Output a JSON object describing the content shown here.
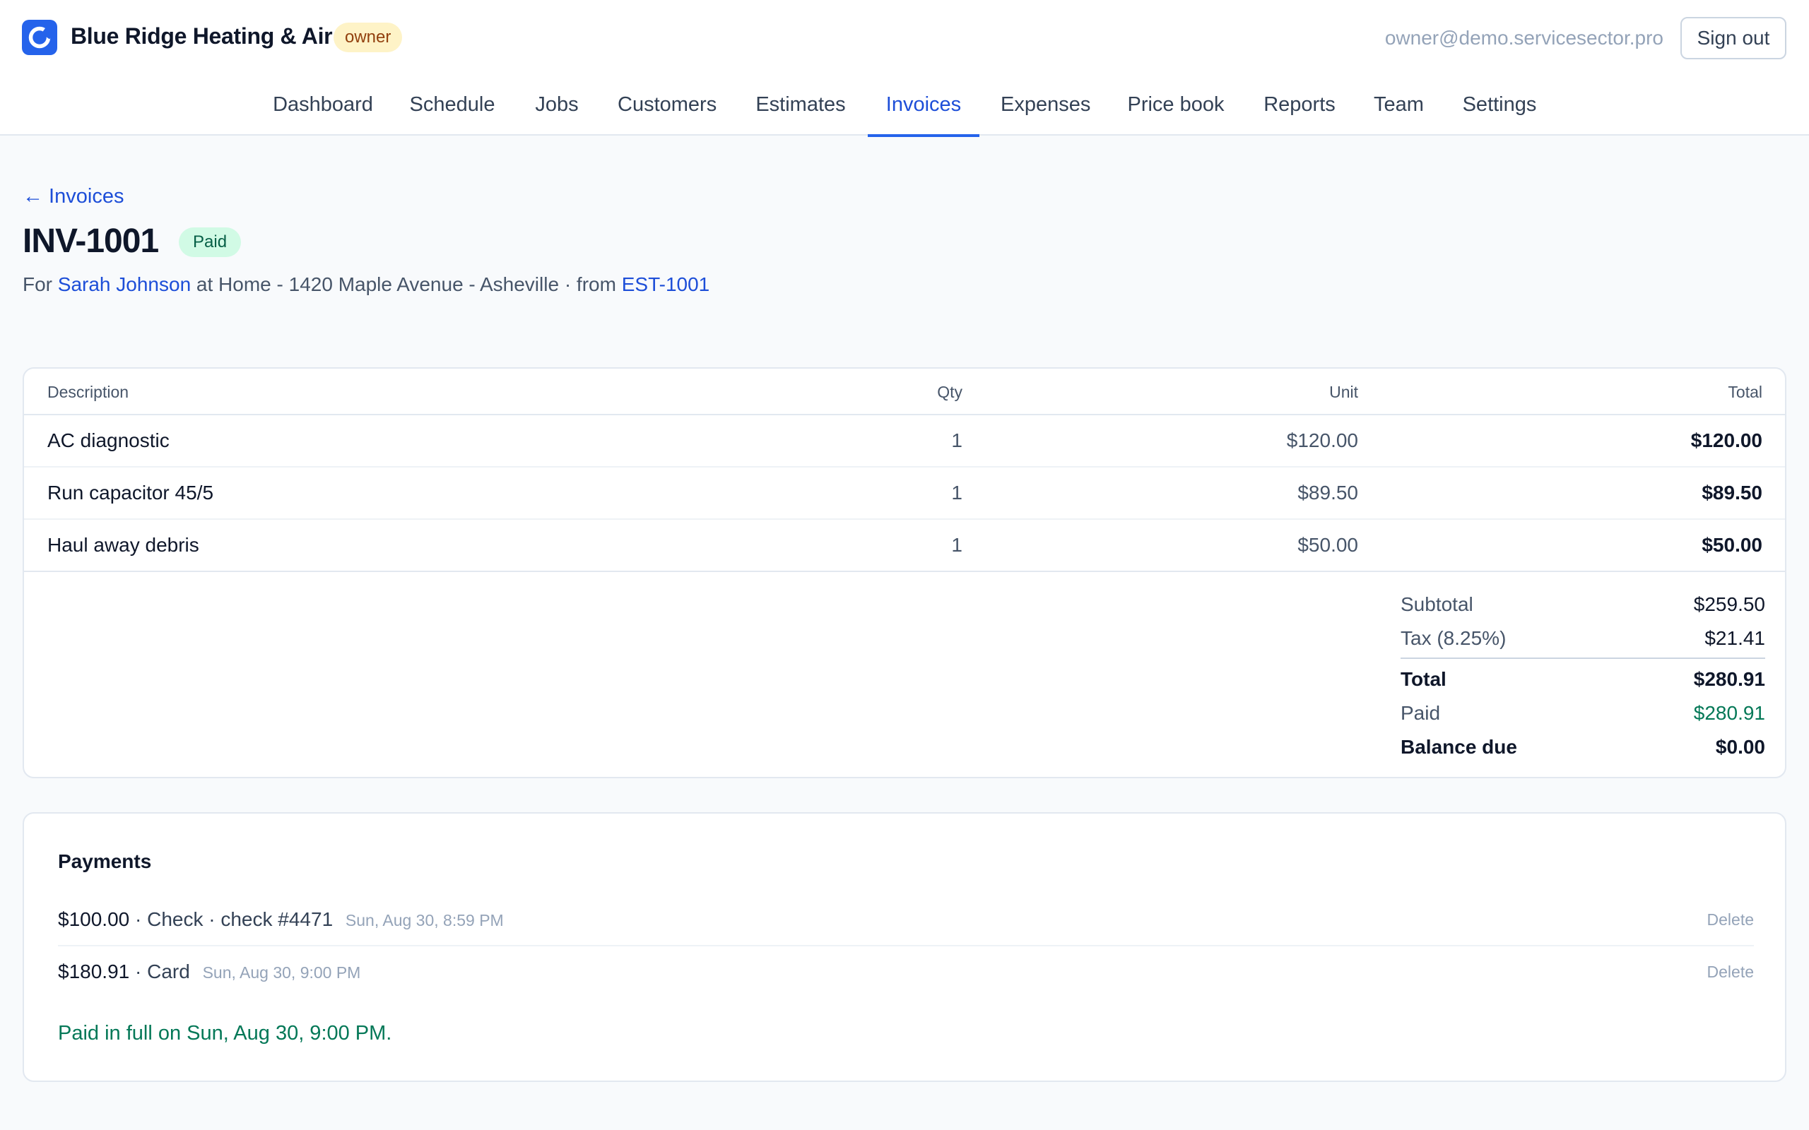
{
  "header": {
    "brand_name": "Blue Ridge Heating & Air",
    "role_badge": "owner",
    "user_email": "owner@demo.servicesector.pro",
    "sign_out_label": "Sign out",
    "accent_color": "#2563eb"
  },
  "nav": {
    "items": [
      {
        "label": "Dashboard"
      },
      {
        "label": "Schedule"
      },
      {
        "label": "Jobs"
      },
      {
        "label": "Customers"
      },
      {
        "label": "Estimates"
      },
      {
        "label": "Invoices"
      },
      {
        "label": "Expenses"
      },
      {
        "label": "Price book"
      },
      {
        "label": "Reports"
      },
      {
        "label": "Team"
      },
      {
        "label": "Settings"
      }
    ],
    "active": "Invoices"
  },
  "page": {
    "back_link": "← Invoices",
    "title": "INV-1001",
    "status": "Paid",
    "status_color": "#065f46",
    "subtitle_prefix": "For",
    "customer": "Sarah Johnson",
    "location_text": "at Home - 1420 Maple Avenue - Asheville · from",
    "estimate_link": "EST-1001"
  },
  "line_items": {
    "headers": {
      "description": "Description",
      "qty": "Qty",
      "unit": "Unit",
      "total": "Total"
    },
    "rows": [
      {
        "description": "AC diagnostic",
        "qty": "1",
        "unit": "$120.00",
        "total": "$120.00"
      },
      {
        "description": "Run capacitor 45/5",
        "qty": "1",
        "unit": "$89.50",
        "total": "$89.50"
      },
      {
        "description": "Haul away debris",
        "qty": "1",
        "unit": "$50.00",
        "total": "$50.00"
      }
    ]
  },
  "totals": {
    "subtotal_label": "Subtotal",
    "subtotal": "$259.50",
    "tax_label": "Tax (8.25%)",
    "tax": "$21.41",
    "total_label": "Total",
    "total": "$280.91",
    "paid_label": "Paid",
    "paid": "$280.91",
    "balance_label": "Balance due",
    "balance": "$0.00"
  },
  "payments": {
    "title": "Payments",
    "items": [
      {
        "amount": "$100.00",
        "detail": " · Check · check #4471",
        "time": "Sun, Aug 30, 8:59 PM",
        "delete_label": "Delete"
      },
      {
        "amount": "$180.91",
        "detail": " · Card",
        "time": "Sun, Aug 30, 9:00 PM",
        "delete_label": "Delete"
      }
    ],
    "paid_in_full": "Paid in full on Sun, Aug 30, 9:00 PM."
  }
}
